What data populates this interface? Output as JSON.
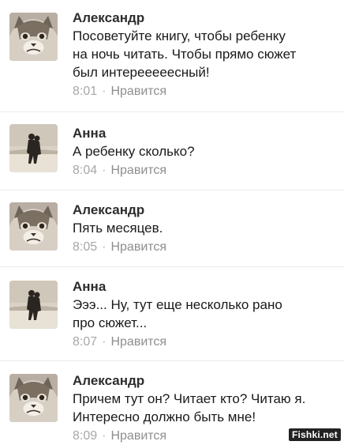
{
  "comments": [
    {
      "author": "Александр",
      "avatar": "grumpy-cat",
      "text": "Посоветуйте книгу, чтобы ребенку\nна ночь читать. Чтобы прямо сюжет\nбыл интерееееесный!",
      "time": "8:01",
      "like": "Нравится"
    },
    {
      "author": "Анна",
      "avatar": "couple-silhouette",
      "text": "А ребенку сколько?",
      "time": "8:04",
      "like": "Нравится"
    },
    {
      "author": "Александр",
      "avatar": "grumpy-cat",
      "text": "Пять месяцев.",
      "time": "8:05",
      "like": "Нравится"
    },
    {
      "author": "Анна",
      "avatar": "couple-silhouette",
      "text": "Эээ... Ну, тут еще несколько рано\nпро сюжет...",
      "time": "8:07",
      "like": "Нравится"
    },
    {
      "author": "Александр",
      "avatar": "grumpy-cat",
      "text": "Причем тут он? Читает кто? Читаю я.\nИнтересно должно быть мне!",
      "time": "8:09",
      "like": "Нравится"
    }
  ],
  "separator": "·",
  "watermark": "Fishki.net"
}
